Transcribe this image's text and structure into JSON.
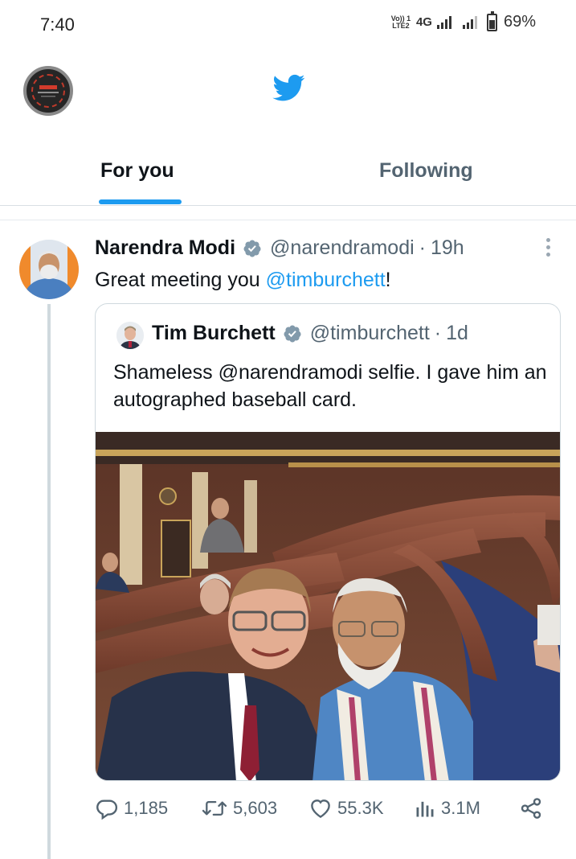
{
  "status_bar": {
    "time": "7:40",
    "volte_line1": "Vo)) 1",
    "volte_line2": "LTE2",
    "network": "4G",
    "battery_percent_text": "69%",
    "battery_level": 0.69
  },
  "header": {
    "app_icon": "twitter-bird-icon",
    "accent_color": "#1d9bf0"
  },
  "tabs": [
    {
      "label": "For you",
      "active": true
    },
    {
      "label": "Following",
      "active": false
    }
  ],
  "tweet": {
    "author_name": "Narendra Modi",
    "author_handle": "@narendramodi",
    "separator": "·",
    "time": "19h",
    "text_before": "Great meeting you ",
    "text_mention": "@timburchett",
    "text_after": "!",
    "quote": {
      "author_name": "Tim Burchett",
      "author_handle": "@timburchett",
      "separator": "·",
      "time": "1d",
      "text": "Shameless @narendramodi selfie. I gave him an autographed baseball card."
    },
    "stats": {
      "replies": "1,185",
      "retweets": "5,603",
      "likes": "55.3K",
      "views": "3.1M"
    }
  }
}
